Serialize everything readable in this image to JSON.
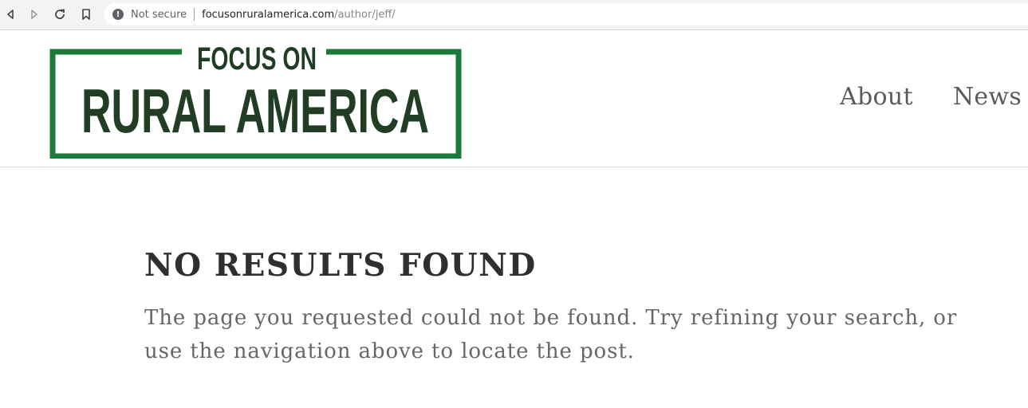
{
  "browser": {
    "security_label": "Not secure",
    "security_icon": "info-icon",
    "url_host": "focusonruralamerica.com",
    "url_path": "/author/jeff/",
    "nav_icons": [
      "back-arrow-icon",
      "forward-arrow-icon",
      "reload-icon",
      "bookmark-icon"
    ]
  },
  "logo": {
    "line1": "FOCUS ON",
    "line2": "RURAL AMERICA",
    "colors": {
      "frame": "#1a7a3a",
      "line1": "#1f3d22",
      "line2": "#213d23"
    }
  },
  "nav": {
    "items": [
      "About",
      "News"
    ]
  },
  "content": {
    "title": "NO RESULTS FOUND",
    "message": "The page you requested could not be found. Try refining your search, or use the navigation above to locate the post."
  }
}
